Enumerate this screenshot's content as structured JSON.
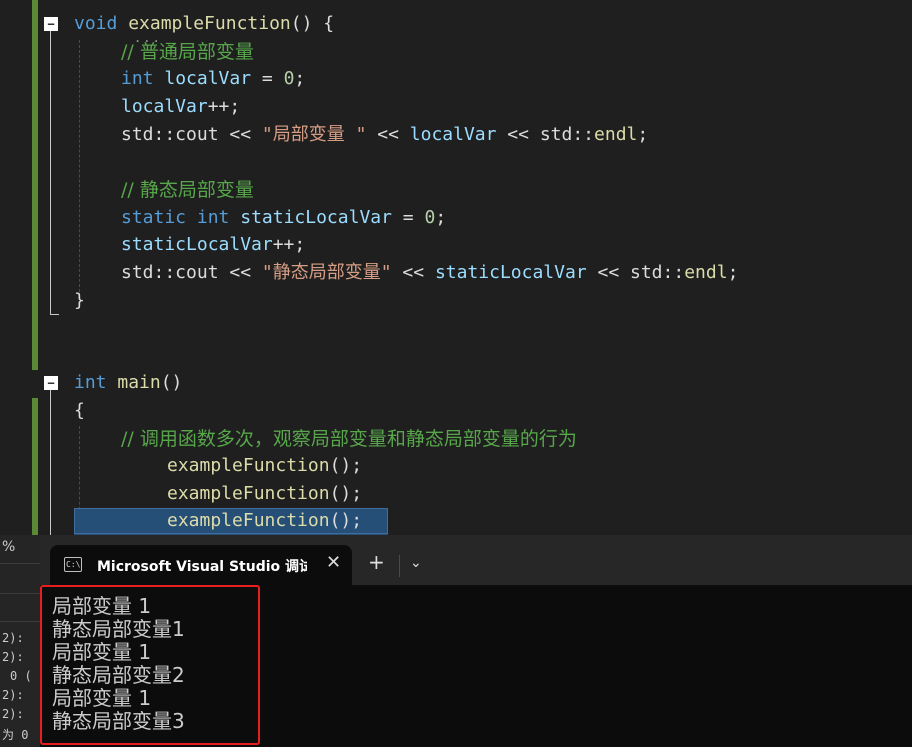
{
  "editor": {
    "fold_icon": "minus-box-icon",
    "lines": [
      "void",
      "exampleFunction",
      "() {",
      "// 普通局部变量",
      "int",
      "localVar",
      " = ",
      "0",
      ";",
      "localVar",
      "++;",
      "std::cout << ",
      "\"局部变量 \"",
      " << ",
      "localVar",
      " << std::",
      "endl",
      ";",
      "// 静态局部变量",
      "static",
      " ",
      "int",
      "staticLocalVar",
      " = ",
      "0",
      ";",
      "staticLocalVar",
      "++;",
      "std::cout << ",
      "\"静态局部变量\"",
      " << ",
      "staticLocalVar",
      " << std::",
      "endl",
      ";",
      "}",
      "int",
      "main",
      "()",
      "{",
      "// 调用函数多次，观察局部变量和静态局部变量的行为",
      "exampleFunction",
      "();",
      "exampleFunction",
      "();",
      "exampleFunction",
      "();"
    ]
  },
  "left_strip": {
    "percent": "%",
    "rows": [
      "2):",
      "2):",
      "0 (",
      "2):",
      "2):",
      "为 0"
    ]
  },
  "terminal": {
    "tab_title": "Microsoft Visual Studio 调试控制台",
    "tab_icon": "console-icon",
    "close_label": "✕",
    "new_tab_label": "+",
    "dropdown_label": "⌄",
    "output": [
      "局部变量 1",
      "静态局部变量1",
      "局部变量 1",
      "静态局部变量2",
      "局部变量 1",
      "静态局部变量3"
    ]
  },
  "colors": {
    "keyword": "#569cd6",
    "function": "#dcdcaa",
    "variable": "#9cdcfe",
    "number": "#b5cea8",
    "string": "#d69d85",
    "comment": "#57a64a",
    "highlight": "#264f78",
    "annotation_box": "#e81e1e"
  }
}
